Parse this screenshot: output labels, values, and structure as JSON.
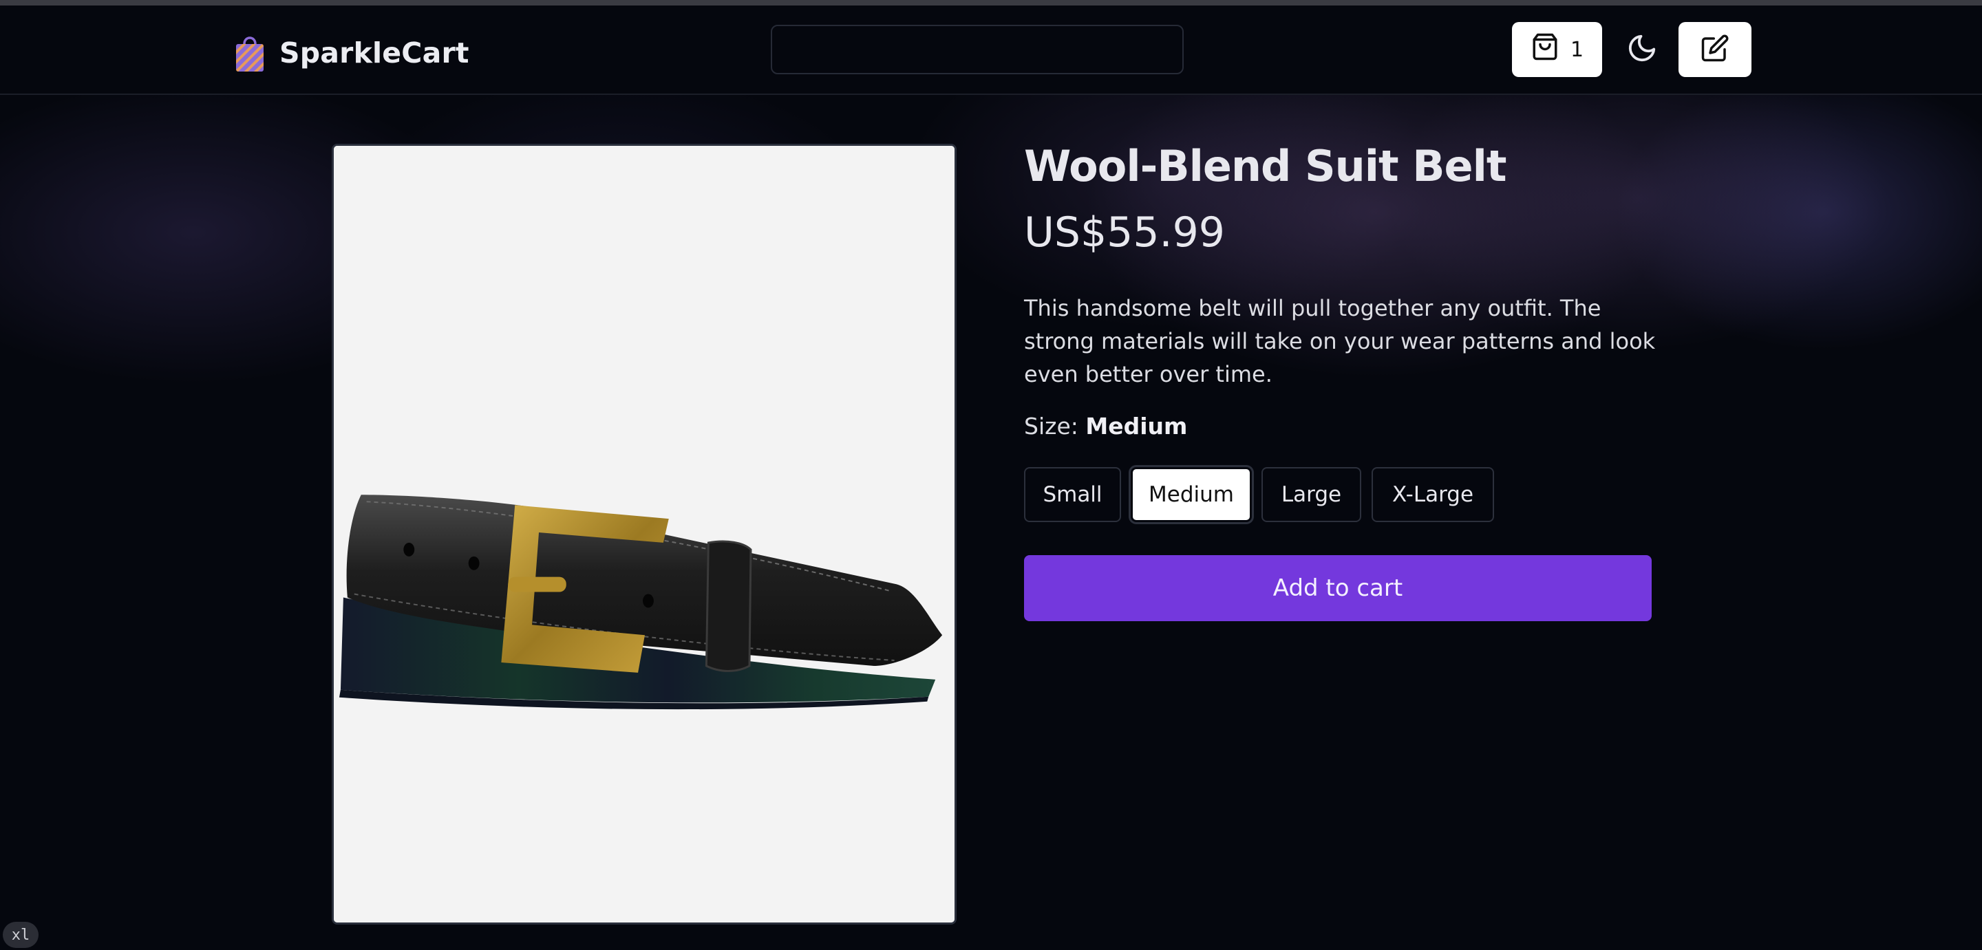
{
  "app": {
    "brand_name": "SparkleCart",
    "brand_icon": "shopping-bag-icon",
    "accent_color": "#7438dd"
  },
  "header": {
    "search": {
      "value": "",
      "placeholder": ""
    },
    "cart": {
      "icon": "shopping-bag-icon",
      "count": "1"
    },
    "theme_toggle_icon": "moon-icon",
    "edit_icon": "edit-icon"
  },
  "product": {
    "title": "Wool-Blend Suit Belt",
    "price": "US$55.99",
    "description": "This handsome belt will pull together any outfit. The strong materials will take on your wear patterns and look even better over time.",
    "size_label": "Size:",
    "selected_size": "Medium",
    "sizes": [
      {
        "label": "Small",
        "selected": false
      },
      {
        "label": "Medium",
        "selected": true
      },
      {
        "label": "Large",
        "selected": false
      },
      {
        "label": "X-Large",
        "selected": false
      }
    ],
    "add_to_cart_label": "Add to cart",
    "image_subject": "belt-image"
  },
  "debug": {
    "breakpoint": "xl"
  }
}
